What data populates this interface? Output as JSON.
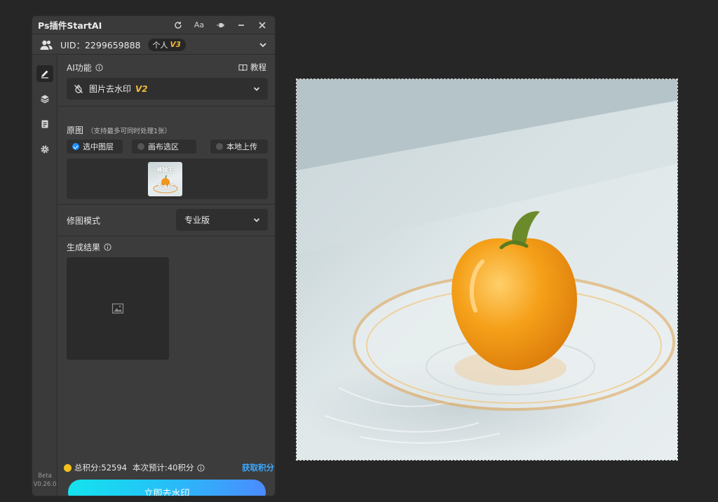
{
  "app": {
    "title": "Ps插件StartAI"
  },
  "titlebar": {
    "font_label": "Aa"
  },
  "user": {
    "uid_text": "UID：2299659888",
    "plan": "个人",
    "level": "V3"
  },
  "ai": {
    "section_label": "AI功能",
    "tutorial_label": "教程",
    "function_name": "图片去水印",
    "function_version": "V2"
  },
  "source": {
    "label": "原图",
    "hint": "（支持最多可同时处理1张）",
    "options": [
      "选中图层",
      "画布选区",
      "本地上传"
    ],
    "selected": "选中图层",
    "thumb_watermark_top": "移除王",
    "thumb_watermark_bottom": "去水印"
  },
  "mode": {
    "label": "修图模式",
    "selected": "专业版"
  },
  "result": {
    "label": "生成结果"
  },
  "points": {
    "total": "总积分:52594",
    "estimate": "本次预计:40积分",
    "get_label": "获取积分"
  },
  "action": {
    "label": "立即去水印"
  },
  "version": {
    "line1": "Beta",
    "line2": "V0.26.0"
  },
  "colors": {
    "accent": "#f5b935",
    "link": "#3ea8ff",
    "cta_start": "#14e3ee",
    "cta_end": "#4b8bff",
    "coin": "#f5c21b"
  },
  "icons": {
    "titlebar": [
      "refresh-icon",
      "font-icon",
      "pin-icon",
      "minimize-icon",
      "close-icon"
    ],
    "sidebar": [
      "brush-icon",
      "layers-icon",
      "clipboard-icon",
      "gear-icon"
    ]
  }
}
